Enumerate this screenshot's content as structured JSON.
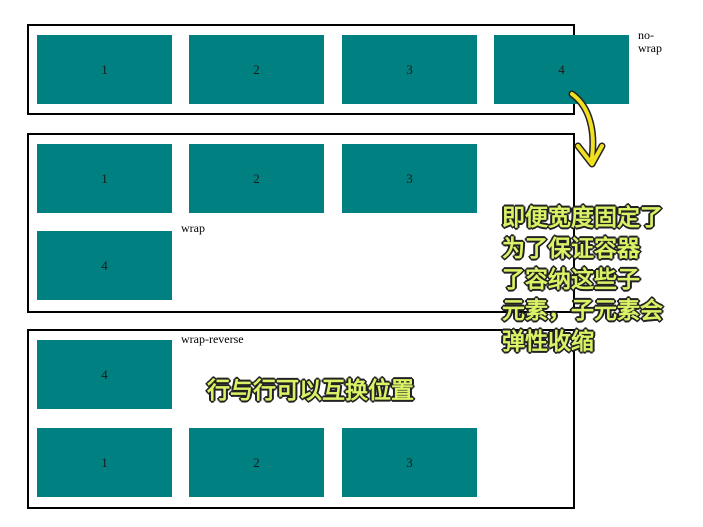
{
  "colors": {
    "box_fill": "#008080",
    "border": "#000000",
    "annotation_text": "#d9f266",
    "annotation_outline": "#222222",
    "arrow": "#f0e020"
  },
  "nowrap": {
    "label": "no-\nwrap",
    "boxes": [
      "1",
      "2",
      "3",
      "4"
    ]
  },
  "wrap": {
    "label": "wrap",
    "boxes": [
      "1",
      "2",
      "3",
      "4"
    ]
  },
  "wrap_reverse": {
    "label": "wrap-reverse",
    "boxes": [
      "4",
      "1",
      "2",
      "3"
    ]
  },
  "annotations": {
    "shrink_note_lines": [
      "即便宽度固定了",
      "为了保证容器",
      "了容纳这些子",
      "元素，子元素会",
      "弹性收缩"
    ],
    "swap_note": "行与行可以互换位置"
  },
  "icons": {
    "arrow": "curved-arrow-icon"
  }
}
